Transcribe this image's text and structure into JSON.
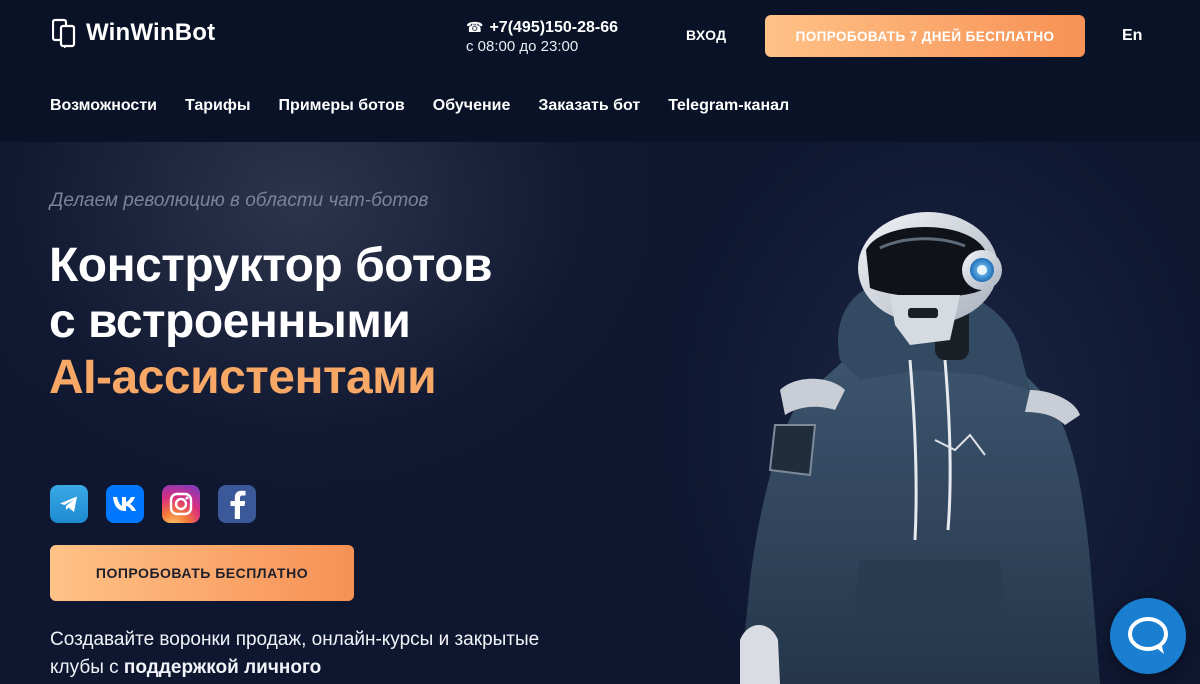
{
  "header": {
    "logo_text": "WinWinBot",
    "phone": "+7(495)150-28-66",
    "hours": "с 08:00 до 23:00",
    "login_label": "ВХОД",
    "try_button_label": "ПОПРОБОВАТЬ 7 ДНЕЙ БЕСПЛАТНО",
    "lang_label": "En"
  },
  "nav": {
    "items": [
      {
        "label": "Возможности"
      },
      {
        "label": "Тарифы"
      },
      {
        "label": "Примеры ботов"
      },
      {
        "label": "Обучение"
      },
      {
        "label": "Заказать бот"
      },
      {
        "label": "Telegram-канал"
      }
    ]
  },
  "hero": {
    "tagline": "Делаем революцию в области чат-ботов",
    "headline_line1": "Конструктор ботов",
    "headline_line2": "с встроенными",
    "headline_accent": "AI-ассистентами",
    "socials": [
      "telegram-icon",
      "vk-icon",
      "instagram-icon",
      "facebook-icon"
    ],
    "cta_label": "ПОПРОБОВАТЬ БЕСПЛАТНО",
    "subtext_plain": "Создавайте воронки продаж, онлайн-курсы и закрытые клубы с ",
    "subtext_bold": "поддержкой личного"
  },
  "colors": {
    "background": "#0a1228",
    "accent": "#f7a766",
    "button_gradient_start": "#ffc287",
    "button_gradient_end": "#f79155",
    "chat_widget": "#1a7fd1"
  }
}
